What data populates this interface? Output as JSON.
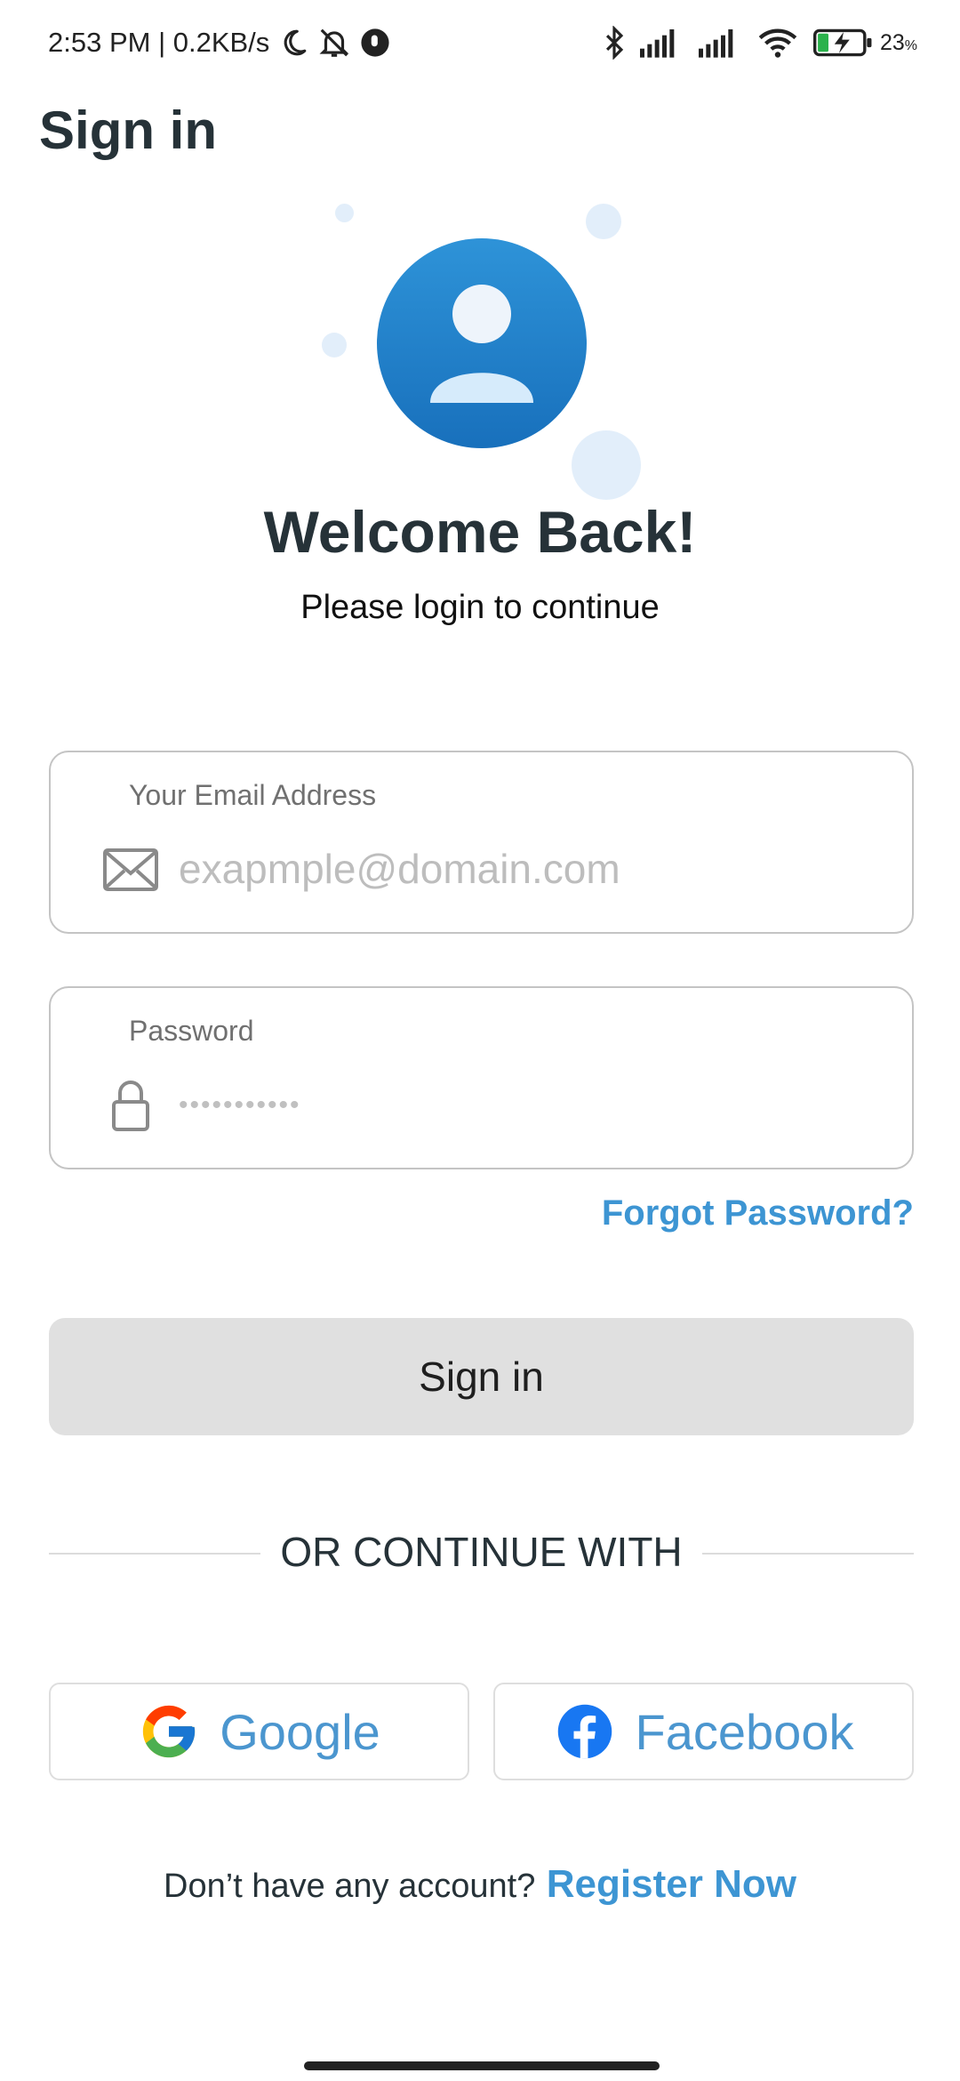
{
  "status_bar": {
    "time": "2:53 PM",
    "network_speed": "0.2KB/s",
    "battery_percent": "23",
    "battery_unit": "%",
    "icons_left": [
      "moon-icon",
      "bell-off-icon",
      "app-badge-icon"
    ],
    "icons_right": [
      "bluetooth-icon",
      "signal-icon",
      "signal-icon",
      "wifi-icon",
      "battery-charging-icon"
    ]
  },
  "header": {
    "title": "Sign in"
  },
  "hero": {
    "title": "Welcome Back!",
    "subtitle": "Please login to continue",
    "avatar_icon": "user-avatar-icon"
  },
  "form": {
    "email": {
      "label": "Your Email Address",
      "placeholder": "exapmple@domain.com",
      "value": "",
      "icon": "mail-icon"
    },
    "password": {
      "label": "Password",
      "placeholder": "•••••••••••",
      "icon": "lock-icon"
    },
    "forgot_link": "Forgot Password?",
    "submit_label": "Sign in"
  },
  "divider": {
    "text": "OR CONTINUE WITH"
  },
  "social": {
    "google": {
      "label": "Google",
      "icon": "google-icon"
    },
    "facebook": {
      "label": "Facebook",
      "icon": "facebook-icon"
    }
  },
  "register": {
    "prompt": "Don’t have any account?",
    "link": "Register Now"
  },
  "colors": {
    "accent": "#3d95d3",
    "avatar_blue": "#1f80c9",
    "button_disabled": "#e0e0e0",
    "text_dark": "#263238"
  }
}
